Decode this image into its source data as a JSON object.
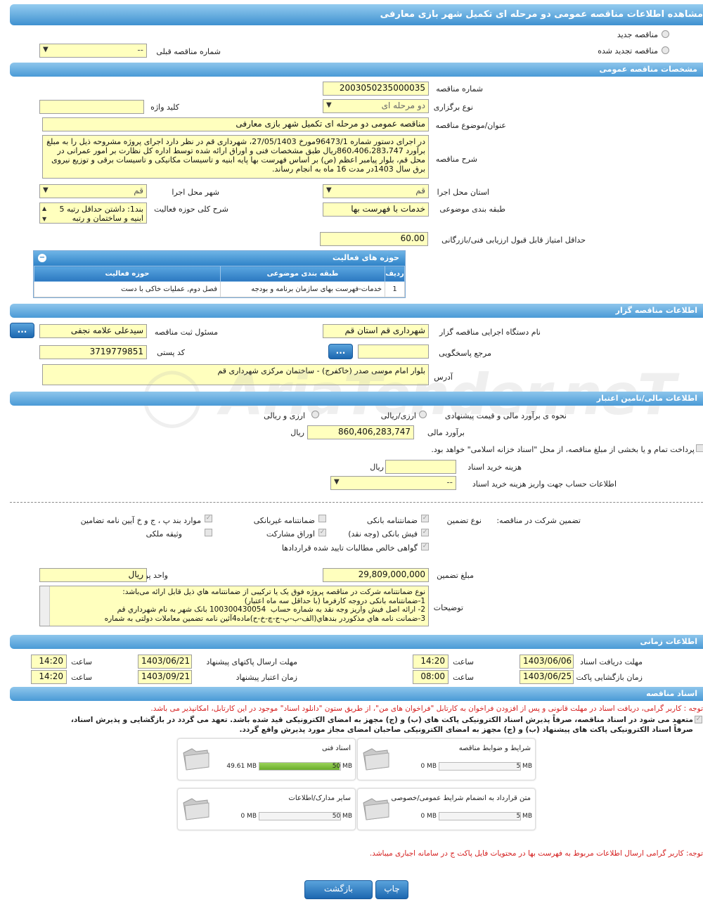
{
  "page_title": "مشاهده اطلاعات مناقصه عمومی دو مرحله ای تکمیل شهر بازی معارفی",
  "tender_type": {
    "new": "مناقصه جدید",
    "renewed": "مناقصه تجدید شده",
    "prev_number_label": "شماره مناقصه قبلی",
    "prev_number_value": "--"
  },
  "general": {
    "header": "مشخصات مناقصه عمومی",
    "number_label": "شماره مناقصه",
    "number": "2003050235000035",
    "method_label": "نوع برگزاری",
    "method": "دو مرحله ای",
    "keyword_label": "کلید واژه",
    "keyword": "",
    "title_label": "عنوان/موضوع مناقصه",
    "title": "مناقصه عمومی دو مرحله ای تکمیل شهر بازی معارفی",
    "desc_label": "شرح مناقصه",
    "desc": "در اجرای دستور شماره 96473/1مورخ 27/05/1403، شهرداری قم در نظر دارد اجرای پروژه  مشروحه ذیل را به مبلغ برآورد 860،406،283،747ریال طبق مشخصات فنی و اوراق ارائه شده توسط اداره کل نظارت بر امور عمرانی در محل قم، بلوار پیامبر اعظم (ص)  بر اساس فهرست بها پایه ابنیه و تاسیسات مکانیکی و تاسیسات برقی و توزیع نیروی برق  سال 1403در مدت 16 ماه به انجام رساند.",
    "province_label": "استان محل اجرا",
    "province": "قم",
    "city_label": "شهر محل اجرا",
    "city": "قم",
    "category_label": "طبقه بندی موضوعی",
    "category": "خدمات با فهرست بها",
    "activity_desc_label": "شرح کلی حوزه فعالیت",
    "activity_desc": "بند1: داشتن حداقل رتبه 5 ابنیه و ساختمان و رتبه",
    "min_score_label": "حداقل امتیاز قابل قبول ارزیابی فنی/بازرگانی",
    "min_score": "60.00"
  },
  "activity_grid": {
    "title": "حوزه های فعالیت",
    "headers": [
      "ردیف",
      "طبقه بندی موضوعی",
      "حوزه فعالیت"
    ],
    "rows": [
      [
        "1",
        "خدمات-فهرست بهای سازمان برنامه و بودجه",
        "فصل دوم, عملیات خاکی با دست"
      ]
    ]
  },
  "organizer": {
    "header": "اطلاعات مناقصه گزار",
    "org_label": "نام دستگاه اجرایی مناقصه گزار",
    "org": "شهرداری قم استان قم",
    "resp_label": "مسئول ثبت مناقصه",
    "resp": "سیدعلی علامه نجفی",
    "ref_label": "مرجع پاسخگویی",
    "ref": "",
    "postal_label": "کد پستی",
    "postal": "3719779851",
    "addr_label": "آدرس",
    "addr": "بلوار امام موسی صدر (خاکفرج) - ساختمان مرکزی شهرداری قم",
    "dots": "..."
  },
  "finance": {
    "header": "اطلاعات مالی/تامین اعتبار",
    "method_label": "نحوه ی برآورد مالی و قیمت پیشنهادی",
    "opt1": "ارزی/ریالی",
    "opt2": "ارزی و ریالی",
    "estimate_label": "برآورد مالی",
    "estimate": "860,406,283,747",
    "currency": "ریال",
    "treasury_text": "پرداخت تمام و یا بخشی از مبلغ مناقصه، از محل \"اسناد خزانه اسلامی\" خواهد بود.",
    "doc_cost_label": "هزینه خرید اسناد",
    "doc_cost": "",
    "doc_cost_unit": "ریال",
    "account_label": "اطلاعات حساب جهت واریز هزینه خرید اسناد",
    "account": "--"
  },
  "guarantee": {
    "label": "تضمین شرکت در مناقصه:",
    "type_label": "نوع تضمین",
    "opts": [
      "ضمانتنامه بانکی",
      "ضمانتنامه غیربانکی",
      "موارد بند پ ، ج و خ آیین نامه تضامین",
      "فیش بانکی (وجه نقد)",
      "اوراق مشارکت",
      "وثیقه ملکی",
      "گواهی خالص مطالبات تایید شده قراردادها"
    ],
    "amount_label": "مبلغ تضمین",
    "amount": "29,809,000,000",
    "unit_label": "واحد پول",
    "unit": "ریال",
    "notes_label": "توضیحات",
    "notes": "نوع ضمانتنامه شرکت در مناقصه پروژه فوق یک یا ترکیبی از ضمانتنامه هاي ذيل قابل ارائه می‌باشد:\n1-ضمانتنامه بانکی دروجه کارفرما (با حداقل سه ماه اعتبار)\n2- ارائه اصل فیش واریز وجه نقد به شماره حساب  100300430054 بانک شهر به نام شهرداري قم\n3-ضمانت نامه هاي مذکوردر بندهاي(الف-ب-پ-ج-چ-خ-ح)ماده4آئین نامه تضمین معاملات دولتی به شماره"
  },
  "timing": {
    "header": "اطلاعات زمانی",
    "receive_label": "مهلت دریافت اسناد",
    "receive_date": "1403/06/06",
    "receive_time": "14:20",
    "send_label": "مهلت ارسال پاکتهای پیشنهاد",
    "send_date": "1403/06/21",
    "send_time": "14:20",
    "open_label": "زمان بازگشایی پاکت ها",
    "open_date": "1403/06/25",
    "open_time": "08:00",
    "valid_label": "زمان اعتبار پیشنهاد",
    "valid_date": "1403/09/21",
    "valid_time": "14:20",
    "time_label": "ساعت"
  },
  "docs": {
    "header": "اسناد مناقصه",
    "note1": "توجه : کاربر گرامی، دریافت اسناد در مهلت قانونی و پس از افزودن فراخوان به کارتابل \"فراخوان های من\"، از طریق ستون \"دانلود اسناد\" موجود در این کارتابل، امکانپذیر می باشد.",
    "commit1": "متعهد می شود در اسناد مناقصه، صرفاً پذیرش اسناد الکترونیکی پاکت های (ب) و (ج) مجهز به امضای الکترونیکی قید شده باشد. تعهد می گردد در بازگشایی و پذیرش اسناد،",
    "commit2": "صرفاً اسناد الکترونیکی پاکت های پیشنهاد (ب) و (ج) مجهز به امضای الکترونیکی صاحبان امضای مجاز مورد پذیرش واقع گردد.",
    "boxes": [
      {
        "title": "شرایط و ضوابط مناقصه",
        "cur": "0 MB",
        "max": "5 MB",
        "fill": 0
      },
      {
        "title": "اسناد فنی",
        "cur": "49.61 MB",
        "max": "50 MB",
        "fill": 0.99
      },
      {
        "title": "متن قرارداد به انضمام شرایط عمومی/خصوصی",
        "cur": "0 MB",
        "max": "5 MB",
        "fill": 0
      },
      {
        "title": "سایر مدارک/اطلاعات",
        "cur": "0 MB",
        "max": "50 MB",
        "fill": 0
      }
    ],
    "note2": "توجه: کاربر گرامی ارسال اطلاعات مربوط به فهرست بها در محتویات فایل پاکت ج در سامانه اجباری میباشد."
  },
  "buttons": {
    "print": "چاپ",
    "back": "بازگشت"
  },
  "watermark": "AriaTender.neT"
}
